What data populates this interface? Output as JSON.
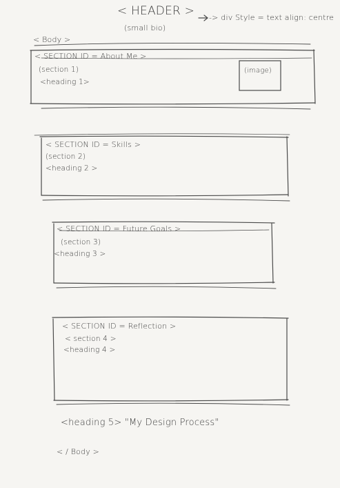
{
  "header": {
    "tag": "< HEADER >",
    "note": "-> div Style = text align: centre",
    "sub": "(small bio)"
  },
  "body_open": "< Body >",
  "sections": [
    {
      "id_line": "< SECTION ID = About Me >",
      "label": "(section 1)",
      "heading": "<heading 1>",
      "image": "(image)"
    },
    {
      "id_line": "< SECTION ID = Skills >",
      "label": "(section 2)",
      "heading": "<heading 2 >"
    },
    {
      "id_line": "< SECTION ID = Future Goals >",
      "label": "(section 3)",
      "heading": "<heading 3 >"
    },
    {
      "id_line": "< SECTION ID = Reflection >",
      "label": "< section 4 >",
      "heading": "<heading 4 >"
    }
  ],
  "heading5": "<heading 5> \"My Design Process\"",
  "body_close": "< / Body >"
}
